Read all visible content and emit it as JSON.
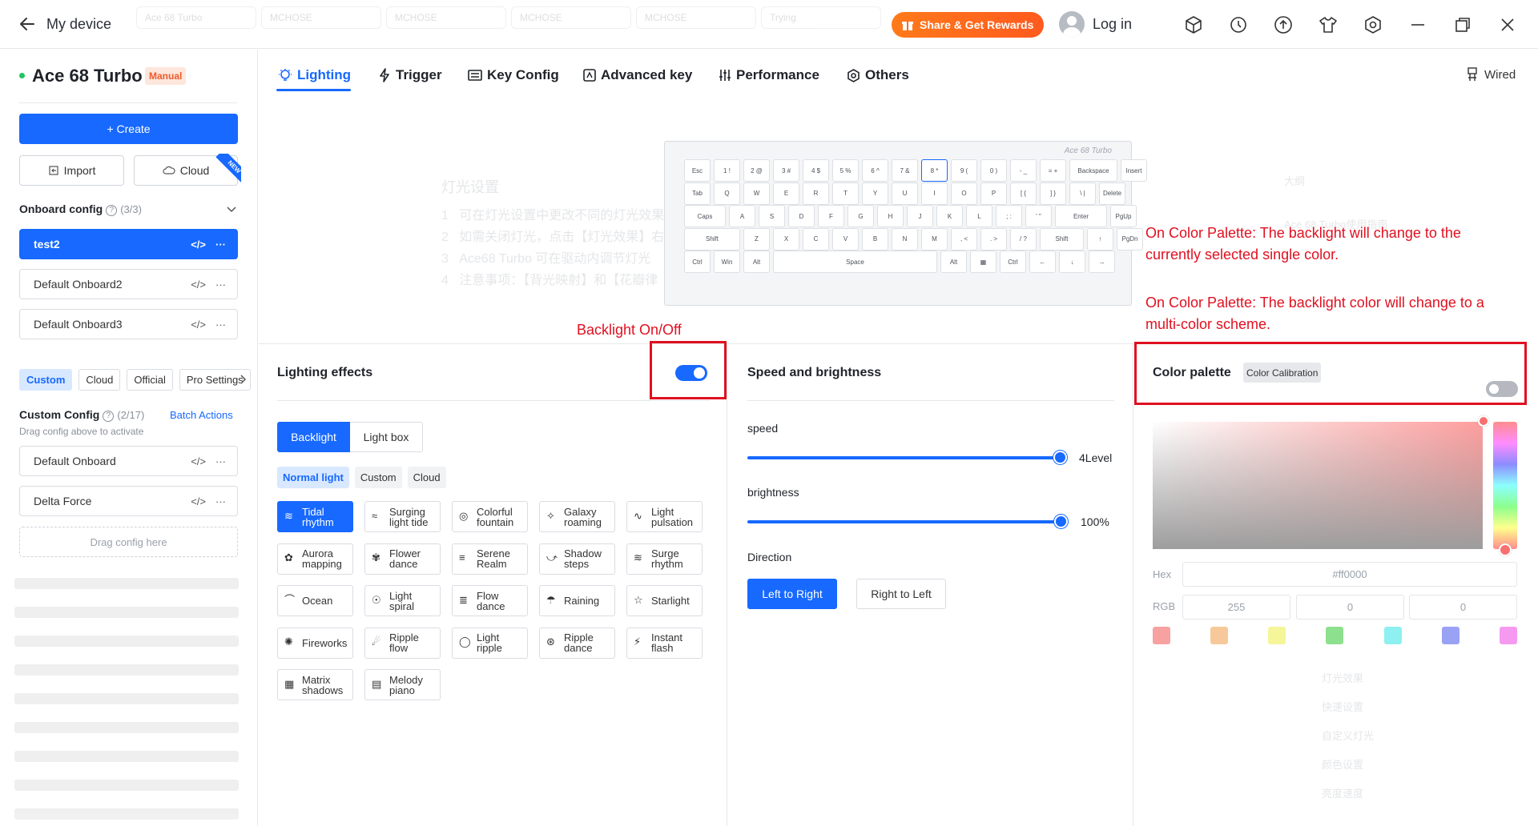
{
  "header": {
    "back_icon": "arrow-left-icon",
    "title": "My device",
    "share_label": "Share & Get Rewards",
    "login_label": "Log in",
    "ghost_tabs": [
      "Ace 68 Turbo",
      "MCHOSE",
      "MCHOSE",
      "MCHOSE",
      "MCHOSE",
      "Trying"
    ],
    "window_icons": [
      "cube-icon",
      "history-icon",
      "upload-icon",
      "tshirt-icon",
      "settings-hex-icon",
      "minimize-icon",
      "restore-icon",
      "close-icon"
    ]
  },
  "sidebar": {
    "device_name": "Ace 68 Turbo",
    "mode_badge": "Manual",
    "create_label": "+ Create",
    "import_label": "Import",
    "cloud_label": "Cloud",
    "new_ribbon": "NEW",
    "onboard_title": "Onboard config",
    "onboard_count": "(3/3)",
    "onboard_items": [
      "test2",
      "Default Onboard2",
      "Default Onboard3"
    ],
    "filter_chips": [
      "Custom",
      "Cloud",
      "Official",
      "Pro Settings"
    ],
    "custom_title": "Custom Config",
    "custom_count": "(2/17)",
    "batch_label": "Batch Actions",
    "drag_hint": "Drag config above to activate",
    "custom_items": [
      "Default Onboard",
      "Delta Force"
    ],
    "drag_box": "Drag config here"
  },
  "tabs": [
    "Lighting",
    "Trigger",
    "Key Config",
    "Advanced key",
    "Performance",
    "Others"
  ],
  "connection": "Wired",
  "keyboard": {
    "brand": "Ace 68 Turbo",
    "rows": [
      [
        "Esc",
        "1 !",
        "2 @",
        "3 #",
        "4 $",
        "5 %",
        "6 ^",
        "7 &",
        "8 *",
        "9 (",
        "0 )",
        "- _",
        "= +",
        "Backspace",
        "Insert"
      ],
      [
        "Tab",
        "Q",
        "W",
        "E",
        "R",
        "T",
        "Y",
        "U",
        "I",
        "O",
        "P",
        "[ {",
        "] }",
        "\\ |",
        "Delete"
      ],
      [
        "Caps",
        "A",
        "S",
        "D",
        "F",
        "G",
        "H",
        "J",
        "K",
        "L",
        "; :",
        "' \"",
        "Enter",
        "PgUp"
      ],
      [
        "Shift",
        "Z",
        "X",
        "C",
        "V",
        "B",
        "N",
        "M",
        ", <",
        ". >",
        "/ ?",
        "Shift",
        "↑",
        "PgDn"
      ],
      [
        "Ctrl",
        "Win",
        "Alt",
        "Space",
        "Alt",
        "▦",
        "Ctrl",
        "←",
        "↓",
        "→"
      ]
    ]
  },
  "annotations": {
    "backlight": "Backlight On/Off",
    "palette_single": "On Color Palette: The backlight will change to the currently selected single color.",
    "palette_multi": "On Color Palette: The backlight color will change to a multi-color scheme."
  },
  "lighting": {
    "title": "Lighting effects",
    "backlight_on": true,
    "mode_tabs": [
      "Backlight",
      "Light box"
    ],
    "sub_tabs": [
      "Normal light",
      "Custom",
      "Cloud"
    ],
    "effects": [
      [
        "Tidal",
        "rhythm"
      ],
      [
        "Surging",
        "light tide"
      ],
      [
        "Colorful",
        "fountain"
      ],
      [
        "Galaxy",
        "roaming"
      ],
      [
        "Light",
        "pulsation"
      ],
      [
        "Aurora",
        "mapping"
      ],
      [
        "Flower",
        "dance"
      ],
      [
        "Serene",
        "Realm"
      ],
      [
        "Shadow",
        "steps"
      ],
      [
        "Surge",
        "rhythm"
      ],
      [
        "Ocean",
        ""
      ],
      [
        "Light",
        "spiral"
      ],
      [
        "Flow",
        "dance"
      ],
      [
        "Raining",
        ""
      ],
      [
        "Starlight",
        ""
      ],
      [
        "Fireworks",
        ""
      ],
      [
        "Ripple",
        "flow"
      ],
      [
        "Light",
        "ripple"
      ],
      [
        "Ripple",
        "dance"
      ],
      [
        "Instant",
        "flash"
      ],
      [
        "Matrix",
        "shadows"
      ],
      [
        "Melody",
        "piano"
      ]
    ]
  },
  "speed": {
    "title": "Speed and brightness",
    "speed_label": "speed",
    "speed_value": "4Level",
    "speed_fraction": 1.0,
    "brightness_label": "brightness",
    "brightness_value": "100%",
    "brightness_fraction": 1.0,
    "direction_label": "Direction",
    "direction_options": [
      "Left to Right",
      "Right to Left"
    ]
  },
  "palette": {
    "title": "Color palette",
    "calibration": "Color Calibration",
    "enabled": false,
    "hex_label": "Hex",
    "hex_value": "#ff0000",
    "rgb_label": "RGB",
    "rgb": [
      "255",
      "0",
      "0"
    ],
    "swatches": [
      "#f7a1a1",
      "#f7c99a",
      "#f5f59a",
      "#8de08d",
      "#8ef0f0",
      "#9aa2f5",
      "#f59af0"
    ],
    "accent": "#1769ff",
    "annotation_color": "#e01020"
  }
}
